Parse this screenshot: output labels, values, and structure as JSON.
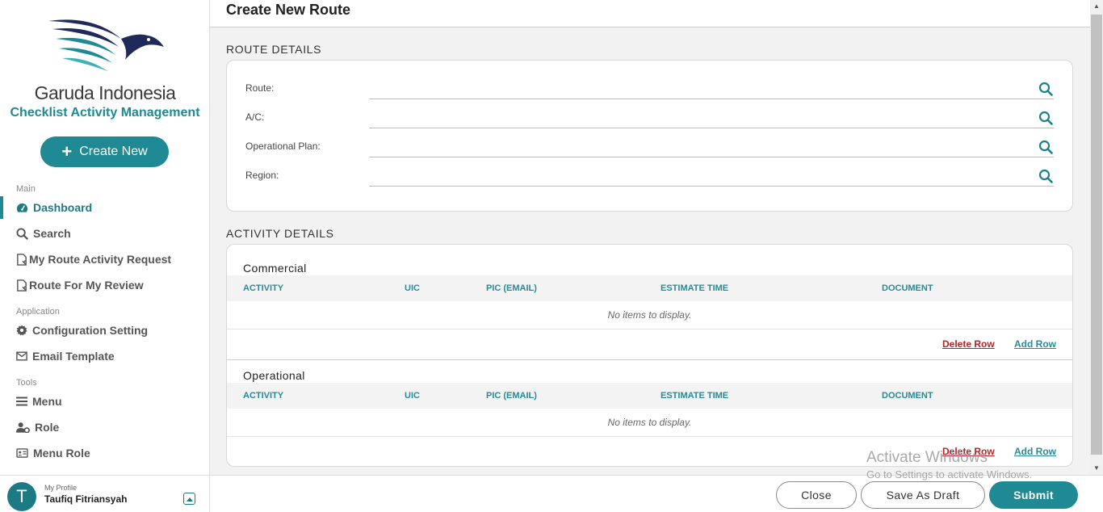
{
  "brand": {
    "name": "Garuda Indonesia",
    "app_name": "Checklist Activity Management",
    "accent": "#1f8a93"
  },
  "sidebar": {
    "create_label": "Create New",
    "sections": {
      "main": "Main",
      "application": "Application",
      "tools": "Tools"
    },
    "items": [
      {
        "label": "Dashboard",
        "icon": "dashboard-icon",
        "active": true
      },
      {
        "label": "Search",
        "icon": "search-icon"
      },
      {
        "label": "My Route Activity Request",
        "icon": "document-icon"
      },
      {
        "label": "Route For My Review",
        "icon": "document-icon"
      },
      {
        "label": "Configuration Setting",
        "icon": "gear-icon"
      },
      {
        "label": "Email Template",
        "icon": "envelope-icon"
      },
      {
        "label": "Menu",
        "icon": "hamburger-icon"
      },
      {
        "label": "Role",
        "icon": "user-gear-icon"
      },
      {
        "label": "Menu Role",
        "icon": "id-card-icon"
      }
    ]
  },
  "profile": {
    "label": "My Profile",
    "name": "Taufiq Fitriansyah",
    "initial": "T"
  },
  "page": {
    "title": "Create New Route"
  },
  "route_details": {
    "heading": "ROUTE DETAILS",
    "fields": [
      {
        "label": "Route:",
        "value": ""
      },
      {
        "label": "A/C:",
        "value": ""
      },
      {
        "label": "Operational Plan:",
        "value": ""
      },
      {
        "label": "Region:",
        "value": ""
      }
    ]
  },
  "activity_details": {
    "heading": "ACTIVITY DETAILS",
    "columns": [
      "ACTIVITY",
      "UIC",
      "PIC (EMAIL)",
      "ESTIMATE TIME",
      "DOCUMENT"
    ],
    "empty_text": "No items to display.",
    "delete_label": "Delete Row",
    "add_label": "Add Row",
    "tables": [
      {
        "title": "Commercial"
      },
      {
        "title": "Operational"
      }
    ]
  },
  "footer": {
    "close_label": "Close",
    "draft_label": "Save As Draft",
    "submit_label": "Submit"
  },
  "watermark": {
    "title": "Activate Windows",
    "subtitle": "Go to Settings to activate Windows."
  }
}
